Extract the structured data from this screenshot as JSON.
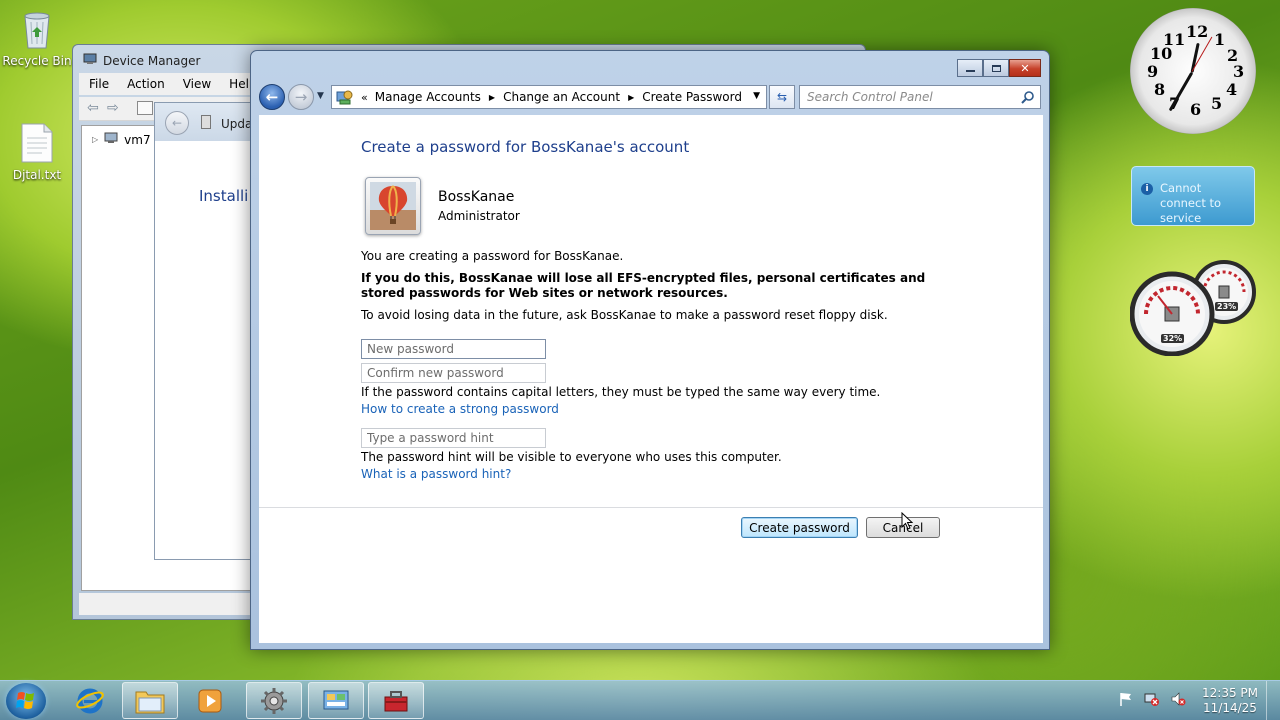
{
  "desktop": {
    "icons": [
      {
        "label": "Recycle Bin"
      },
      {
        "label": "Djtal.txt"
      }
    ]
  },
  "device_manager": {
    "title": "Device Manager",
    "menu": [
      "File",
      "Action",
      "View",
      "Help"
    ],
    "tree_root": "vm7",
    "update_window": {
      "title": "Upda",
      "heading": "Installi"
    }
  },
  "control_panel": {
    "breadcrumb": {
      "overflow": "«",
      "parts": [
        "Manage Accounts",
        "Change an Account",
        "Create Password"
      ]
    },
    "search_placeholder": "Search Control Panel",
    "page_title": "Create a password for BossKanae's account",
    "user": {
      "name": "BossKanae",
      "role": "Administrator"
    },
    "intro": "You are creating a password for BossKanae.",
    "warning": "If you do this, BossKanae will lose all EFS-encrypted files, personal certificates and stored passwords for Web sites or network resources.",
    "advice": "To avoid losing data in the future, ask BossKanae to make a password reset floppy disk.",
    "fields": {
      "new_password": "New password",
      "confirm_password": "Confirm new password",
      "hint": "Type a password hint"
    },
    "caps_note": "If the password contains capital letters, they must be typed the same way every time.",
    "strong_link": "How to create a strong password",
    "hint_note": "The password hint will be visible to everyone who uses this computer.",
    "hint_link": "What is a password hint?",
    "buttons": {
      "create": "Create password",
      "cancel": "Cancel"
    }
  },
  "gadgets": {
    "clock_numbers": [
      "12",
      "1",
      "2",
      "3",
      "4",
      "5",
      "6",
      "7",
      "8",
      "9",
      "10",
      "11"
    ],
    "notice": "Cannot connect to service",
    "meter_cpu": "32%",
    "meter_mem": "23%"
  },
  "taskbar": {
    "time": "12:35 PM",
    "date": "11/14/25"
  },
  "colors": {
    "link": "#1a63b8",
    "title_blue": "#1e3f8c"
  }
}
